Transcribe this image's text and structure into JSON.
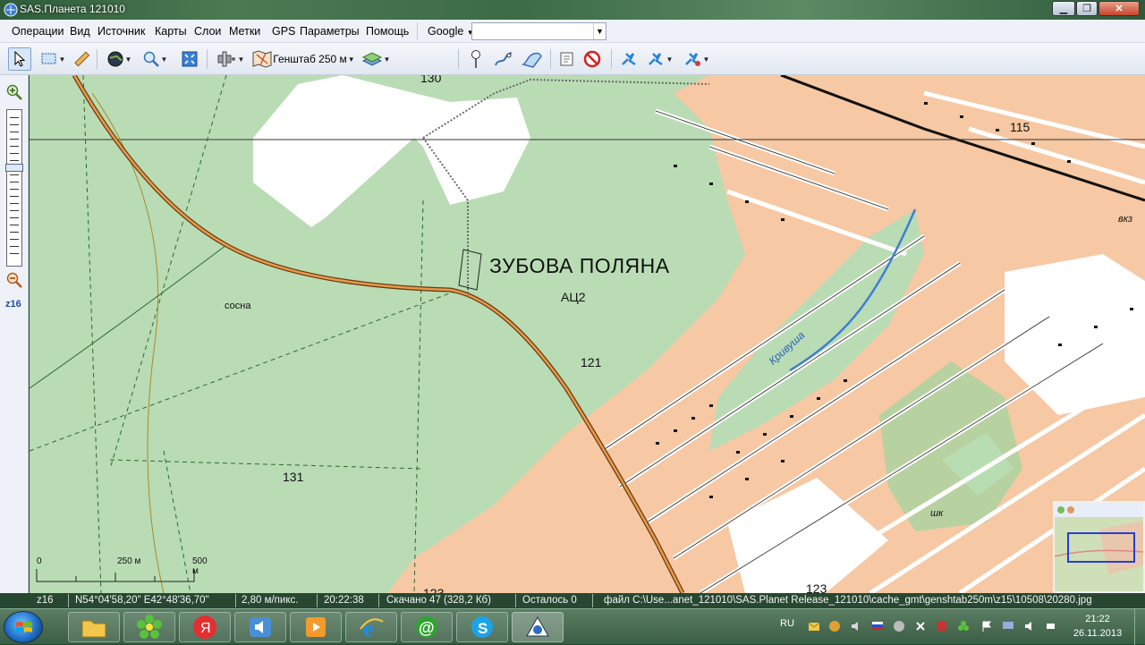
{
  "window": {
    "title": "SAS.Планета 121010"
  },
  "menu": {
    "items": [
      "Операции",
      "Вид",
      "Источник",
      "Карты",
      "Слои",
      "Метки",
      "GPS",
      "Параметры",
      "Помощь"
    ],
    "map_source": "Google",
    "search_value": ""
  },
  "toolbar": {
    "layer_label": "Генштаб 250 м"
  },
  "zoom": {
    "level_label": "z16"
  },
  "map": {
    "labels": {
      "place": "ЗУБОВА ПОЛЯНА",
      "code": "АЦ2",
      "n130": "130",
      "n121": "121",
      "n131": "131",
      "n115": "115",
      "n123a": "123",
      "n123b": "123",
      "pine": "сосна",
      "river": "Кривуша",
      "school": "шк",
      "vkz": "вкз"
    },
    "scale": {
      "t0": "0",
      "t1": "250 м",
      "t2": "500 м"
    }
  },
  "status": {
    "zoom": "z16",
    "coords": "N54°04'58,20\" E42°48'36,70\"",
    "resolution": "2,80 м/пикс.",
    "time": "20:22:38",
    "downloaded": "Скачано 47 (328,2 Кб)",
    "remaining": "Осталось 0",
    "file": "файл C:\\Use...anet_121010\\SAS.Planet Release_121010\\cache_gmt\\genshtab250m\\z15\\10508\\20280.jpg"
  },
  "taskbar": {
    "lang": "RU",
    "clock_time": "21:22",
    "clock_date": "26.11.2013",
    "apps": [
      "explorer",
      "icq",
      "yandex",
      "speaker-app",
      "media-player",
      "ie",
      "mail-agent",
      "skype",
      "sas-planet"
    ]
  }
}
